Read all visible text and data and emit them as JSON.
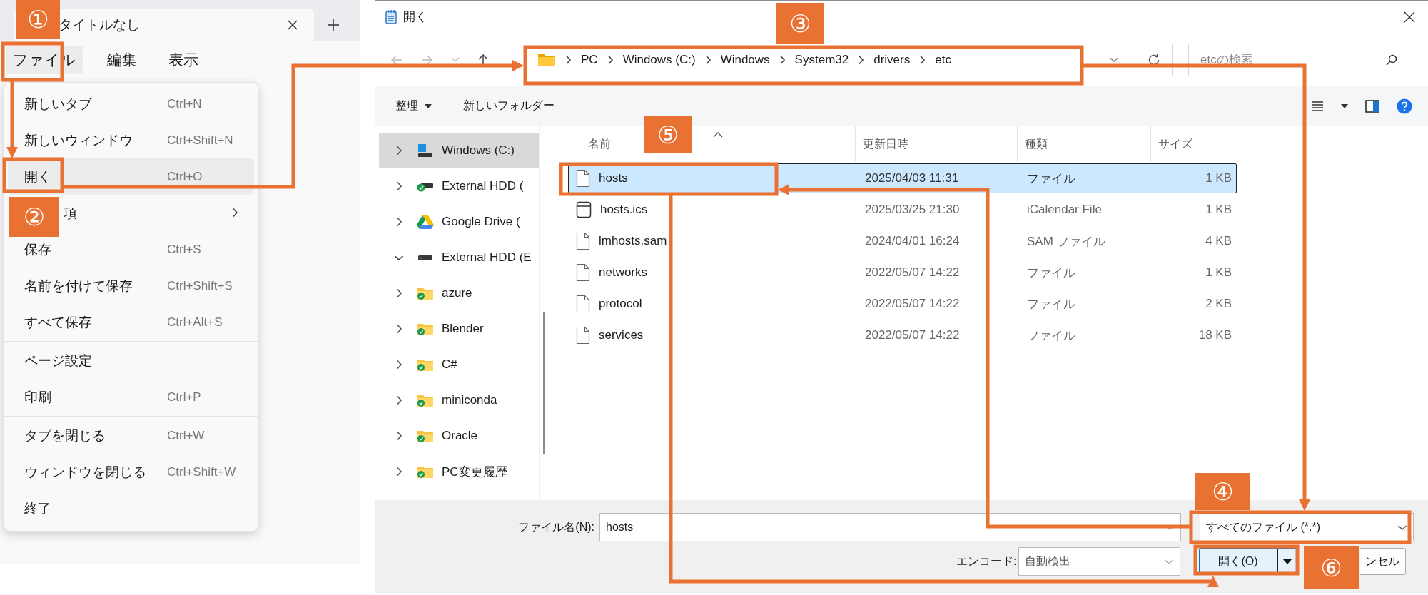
{
  "notepad": {
    "tab_title": "タイトルなし",
    "menubar": [
      {
        "label": "ファイル",
        "selected": true
      },
      {
        "label": "編集",
        "selected": false
      },
      {
        "label": "表示",
        "selected": false
      }
    ],
    "file_menu": [
      {
        "kind": "item",
        "label": "新しいタブ",
        "shortcut": "Ctrl+N",
        "selected": false
      },
      {
        "kind": "item",
        "label": "新しいウィンドウ",
        "shortcut": "Ctrl+Shift+N",
        "selected": false
      },
      {
        "kind": "item",
        "label": "開く",
        "shortcut": "Ctrl+O",
        "selected": true
      },
      {
        "kind": "submenu",
        "label": "項",
        "selected": false
      },
      {
        "kind": "item",
        "label": "保存",
        "shortcut": "Ctrl+S",
        "selected": false
      },
      {
        "kind": "item",
        "label": "名前を付けて保存",
        "shortcut": "Ctrl+Shift+S",
        "selected": false
      },
      {
        "kind": "item",
        "label": "すべて保存",
        "shortcut": "Ctrl+Alt+S",
        "selected": false
      },
      {
        "kind": "separator"
      },
      {
        "kind": "item",
        "label": "ページ設定",
        "selected": false
      },
      {
        "kind": "item",
        "label": "印刷",
        "shortcut": "Ctrl+P",
        "selected": false
      },
      {
        "kind": "separator"
      },
      {
        "kind": "item",
        "label": "タブを閉じる",
        "shortcut": "Ctrl+W",
        "selected": false
      },
      {
        "kind": "item",
        "label": "ウィンドウを閉じる",
        "shortcut": "Ctrl+Shift+W",
        "selected": false
      },
      {
        "kind": "item",
        "label": "終了",
        "selected": false
      }
    ]
  },
  "dialog": {
    "title": "開く",
    "breadcrumb": [
      "PC",
      "Windows (C:)",
      "Windows",
      "System32",
      "drivers",
      "etc"
    ],
    "search": {
      "placeholder": "etcの検索"
    },
    "toolbar": [
      {
        "kind": "menu",
        "label": "整理"
      },
      {
        "kind": "button",
        "label": "新しいフォルダー"
      }
    ],
    "sidebar": [
      {
        "kind": "windows-drive",
        "label": "Windows (C:)",
        "selected": true,
        "expanded": false
      },
      {
        "kind": "synced-drive",
        "label": "External HDD (",
        "selected": false,
        "expanded": false
      },
      {
        "kind": "cloud-drive",
        "label": "Google Drive (",
        "selected": false,
        "expanded": false
      },
      {
        "kind": "drive",
        "label": "External HDD (E",
        "selected": false,
        "expanded": true,
        "children": [
          {
            "kind": "folder",
            "label": "azure",
            "selected": false,
            "expanded": false
          },
          {
            "kind": "folder",
            "label": "Blender",
            "selected": false,
            "expanded": false
          },
          {
            "kind": "folder",
            "label": "C#",
            "selected": false,
            "expanded": false
          },
          {
            "kind": "folder",
            "label": "miniconda",
            "selected": false,
            "expanded": false
          },
          {
            "kind": "folder",
            "label": "Oracle",
            "selected": false,
            "expanded": false
          },
          {
            "kind": "folder",
            "label": "PC変更履歴",
            "selected": false,
            "expanded": false
          }
        ]
      }
    ],
    "columns": [
      "名前",
      "更新日時",
      "種類",
      "サイズ"
    ],
    "rows": [
      {
        "kind": "file",
        "name": "hosts",
        "date": "2025/04/03 11:31",
        "type": "ファイル",
        "size": "1 KB",
        "selected": true
      },
      {
        "kind": "calendar",
        "name": "hosts.ics",
        "date": "2025/03/25 21:30",
        "type": "iCalendar File",
        "size": "1 KB",
        "selected": false
      },
      {
        "kind": "file",
        "name": "lmhosts.sam",
        "date": "2024/04/01 16:24",
        "type": "SAM ファイル",
        "size": "4 KB",
        "selected": false
      },
      {
        "kind": "file",
        "name": "networks",
        "date": "2022/05/07 14:22",
        "type": "ファイル",
        "size": "1 KB",
        "selected": false
      },
      {
        "kind": "file",
        "name": "protocol",
        "date": "2022/05/07 14:22",
        "type": "ファイル",
        "size": "2 KB",
        "selected": false
      },
      {
        "kind": "file",
        "name": "services",
        "date": "2022/05/07 14:22",
        "type": "ファイル",
        "size": "18 KB",
        "selected": false
      }
    ],
    "filename_label": "ファイル名(N):",
    "filename": "hosts",
    "filter": "すべてのファイル (*.*)",
    "encoding_label": "エンコード:",
    "encoding": "自動検出",
    "open_button": "開く(O)",
    "cancel_button": "ンセル"
  },
  "annotations": {
    "badges": [
      "①",
      "②",
      "③",
      "④",
      "⑤",
      "⑥"
    ]
  }
}
